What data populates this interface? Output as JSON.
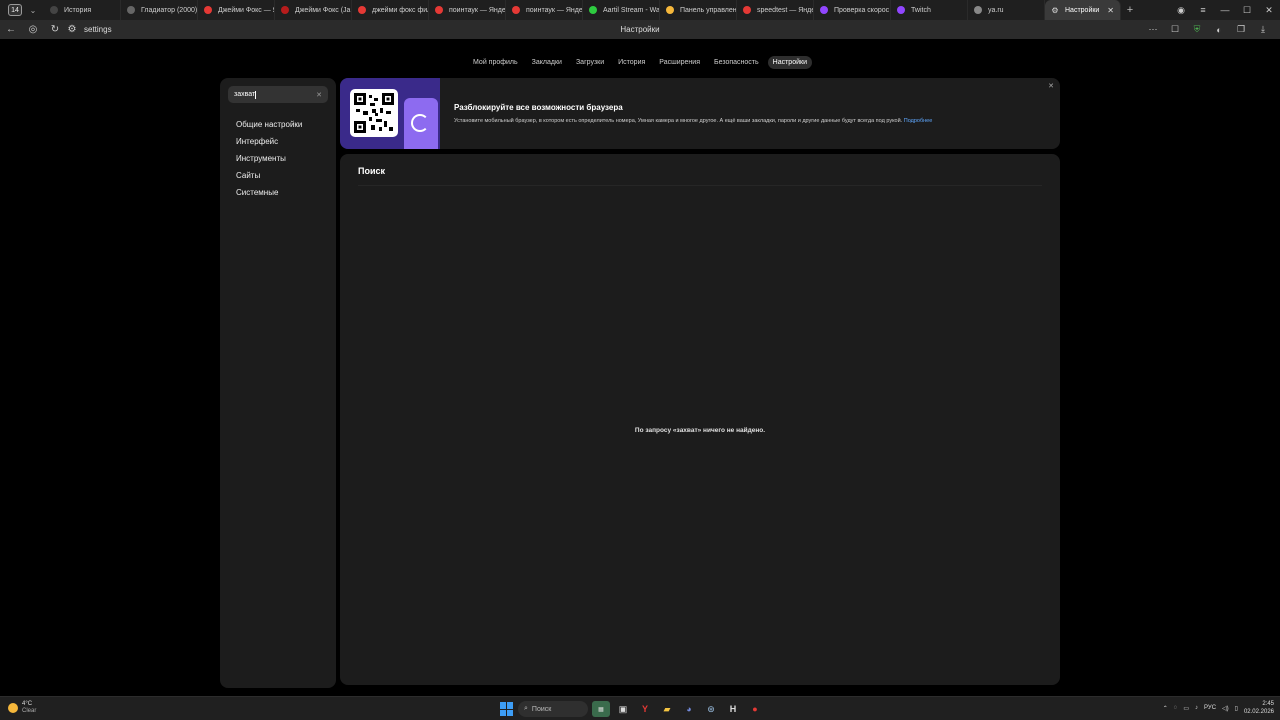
{
  "tabbar": {
    "counter": "14",
    "tabs": [
      {
        "label": "История",
        "fav_color": "#444"
      },
      {
        "label": "Гладиатор (2000)",
        "fav_color": "#666"
      },
      {
        "label": "Джейми Фокс — Я",
        "fav_color": "#e53935"
      },
      {
        "label": "Джейми Фокс (Ja",
        "fav_color": "#b71c1c"
      },
      {
        "label": "джейми фокс фил",
        "fav_color": "#e53935"
      },
      {
        "label": "поинтаук — Яндек",
        "fav_color": "#e53935"
      },
      {
        "label": "поинтаук — Яндек",
        "fav_color": "#e53935"
      },
      {
        "label": "Aartil Stream - Wa",
        "fav_color": "#2ecc40"
      },
      {
        "label": "Панель управлен",
        "fav_color": "#f5b73b"
      },
      {
        "label": "speedtest — Яндек",
        "fav_color": "#e53935"
      },
      {
        "label": "Проверка скорос",
        "fav_color": "#9146ff"
      },
      {
        "label": "Twitch",
        "fav_color": "#9146ff"
      },
      {
        "label": "ya.ru",
        "fav_color": "#888"
      }
    ],
    "active_tab": {
      "label": "Настройки"
    }
  },
  "address": {
    "url": "settings",
    "page_title": "Настройки"
  },
  "topnav": [
    "Мой профиль",
    "Закладки",
    "Загрузки",
    "История",
    "Расширения",
    "Безопасность",
    "Настройки"
  ],
  "topnav_active": "Настройки",
  "sidebar": {
    "search_value": "захват",
    "items": [
      "Общие настройки",
      "Интерфейс",
      "Инструменты",
      "Сайты",
      "Системные"
    ]
  },
  "banner": {
    "title": "Разблокируйте все возможности браузера",
    "text": "Установите мобильный браузер, в котором есть определитель номера, Умная камера и многое другое. А ещё ваши закладки, пароли и другие данные будут всегда под рукой.",
    "link": "Подробнее"
  },
  "content": {
    "title": "Поиск",
    "empty_message": "По запросу «захват» ничего не найдено."
  },
  "taskbar": {
    "weather_temp": "4°C",
    "weather_desc": "Clear",
    "search_label": "Поиск",
    "lang": "РУС",
    "time": "2:45",
    "date": "02.02.2026"
  }
}
